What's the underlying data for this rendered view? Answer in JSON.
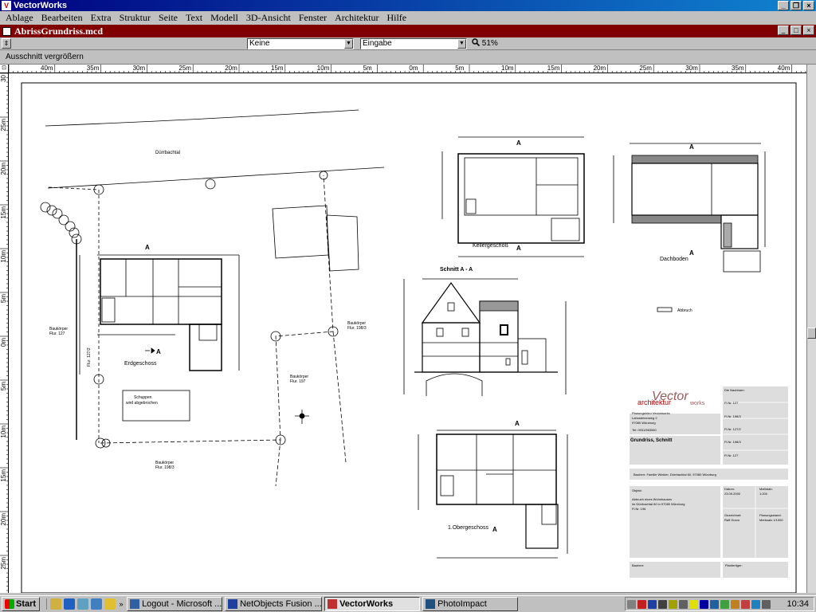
{
  "app": {
    "title": "VectorWorks",
    "minimize": "_",
    "restore": "❐",
    "close": "×"
  },
  "menu": [
    "Ablage",
    "Bearbeiten",
    "Extra",
    "Struktur",
    "Seite",
    "Text",
    "Modell",
    "3D-Ansicht",
    "Fenster",
    "Architektur",
    "Hilfe"
  ],
  "document": {
    "title": "AbrissGrundriss.mcd",
    "minimize": "_",
    "restore": "□",
    "close": "×"
  },
  "toolbar": {
    "layer_value": "Keine",
    "class_value": "Eingabe",
    "zoom": "51%",
    "dropdown_arrow": "▼",
    "toggle_icon": "⇕"
  },
  "hint": "Ausschnitt vergrößern",
  "ruler": {
    "corner": "⊡",
    "h_labels": [
      "40m",
      "35m",
      "30m",
      "25m",
      "20m",
      "15m",
      "10m",
      "5m",
      "0m",
      "5m",
      "10m",
      "15m",
      "20m",
      "25m",
      "30m",
      "35m",
      "40m"
    ],
    "v_labels": [
      "30",
      "25m",
      "20m",
      "15m",
      "10m",
      "5m",
      "0m",
      "5m",
      "10m",
      "15m",
      "20m",
      "25m"
    ]
  },
  "drawing": {
    "street": "Dürrbachtal",
    "plot_left": "Baukörper\nFlur. 127",
    "plot_mid": "Flur. 127/2",
    "plot_right_top": "Baukörper\nFlur. 198/3",
    "plot_center": "Baukörper\nFlur. 197",
    "plot_bottom": "Baukörper\nFlur. 198/3",
    "shed": "Schuppen\nwird abgebrochen",
    "erdgeschoss": "Erdgeschoss",
    "kellergeschoss": "Kellergeschoß",
    "dachboden": "Dachboden",
    "schnitt": "Schnitt A - A",
    "obergeschoss": "1.Obergeschoss",
    "section_mark": "A",
    "legend_abbruch": "Abbruch",
    "north_mark": "N"
  },
  "titleblock": {
    "logo_main": "Vector",
    "logo_sub": "architektur",
    "logo_works": "works",
    "office_lines": [
      "Planungsbüro Vectorworks",
      "Lahnsteinerweg 2",
      "97080 Würzburg",
      "Tel: 0931/563060"
    ],
    "plan_title": "Grundriss, Schnitt",
    "right_header": "Die Nachbarn:",
    "neighbors": [
      "Fl.Nr. 127",
      "Fl.Nr. 198/3",
      "Fl.Nr. 127/2",
      "Fl.Nr. 198/3",
      "Fl.Nr. 127"
    ],
    "owner_line": "Bauherr: Familie Winkler, Dürrbachtal 60, 97080 Würzburg",
    "project_label": "Objekt:",
    "project_lines": [
      "Abbruch eines Wohnhauses",
      "im Dürrbachtal 60 in 97080 Würzburg",
      "Fl.Nr. 196"
    ],
    "date_label": "Datum:",
    "date_value": "23.09.2000",
    "scale_label": "Maßstab:",
    "scale_value": "1:200",
    "drawn_label": "Gezeichnet:",
    "drawn_value": "Ralf Gurzo",
    "plan_label": "Planungsstand:",
    "plan_value": "Merksatz 1/1000",
    "sign_owner": "Bauherr:",
    "sign_planner": "Planfertiger:"
  },
  "taskbar": {
    "start": "Start",
    "ql_more": "»",
    "tasks": [
      {
        "label": "Logout - Microsoft ...",
        "active": false
      },
      {
        "label": "NetObjects Fusion ...",
        "active": false
      },
      {
        "label": "VectorWorks",
        "active": true
      },
      {
        "label": "PhotoImpact",
        "active": false
      }
    ],
    "clock": "10:34"
  },
  "colors": {
    "title_active": "#000080",
    "doc_title": "#800000",
    "face": "#c0c0c0"
  }
}
